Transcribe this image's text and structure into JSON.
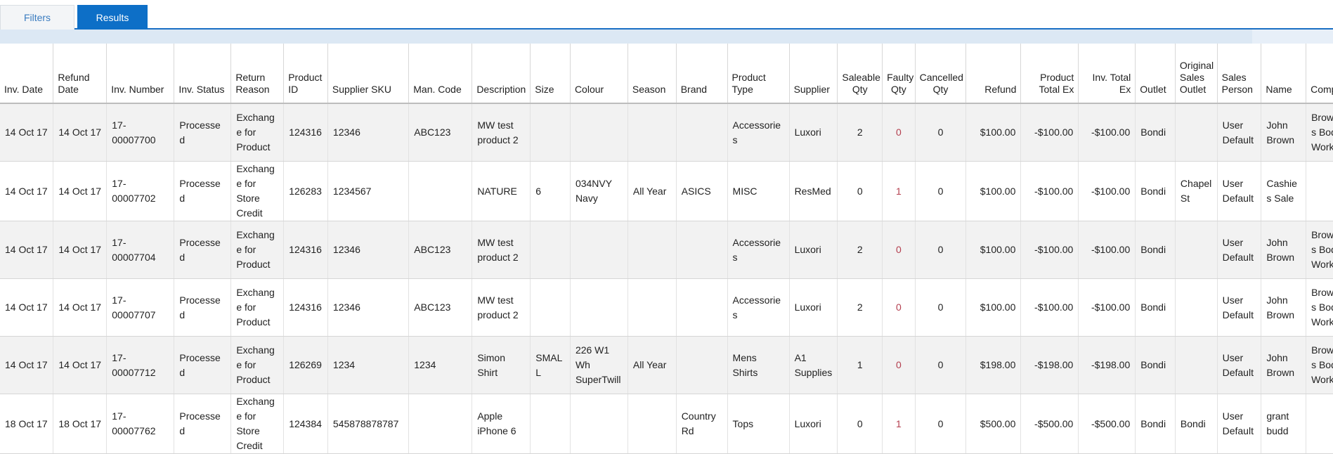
{
  "tabs": {
    "filters": "Filters",
    "results": "Results"
  },
  "columns": [
    {
      "label": "Inv. Date",
      "align": "l"
    },
    {
      "label": "Refund Date",
      "align": "l"
    },
    {
      "label": "Inv. Number",
      "align": "l"
    },
    {
      "label": "Inv. Status",
      "align": "l"
    },
    {
      "label": "Return Reason",
      "align": "l"
    },
    {
      "label": "Product ID",
      "align": "l"
    },
    {
      "label": "Supplier SKU",
      "align": "l"
    },
    {
      "label": "Man. Code",
      "align": "l"
    },
    {
      "label": "Description",
      "align": "l"
    },
    {
      "label": "Size",
      "align": "l"
    },
    {
      "label": "Colour",
      "align": "l"
    },
    {
      "label": "Season",
      "align": "l"
    },
    {
      "label": "Brand",
      "align": "l"
    },
    {
      "label": "Product Type",
      "align": "l"
    },
    {
      "label": "Supplier",
      "align": "l"
    },
    {
      "label": "Saleable Qty",
      "align": "c"
    },
    {
      "label": "Faulty Qty",
      "align": "c"
    },
    {
      "label": "Cancelled Qty",
      "align": "c"
    },
    {
      "label": "Refund",
      "align": "r"
    },
    {
      "label": "Product Total Ex",
      "align": "r"
    },
    {
      "label": "Inv. Total Ex",
      "align": "r"
    },
    {
      "label": "Outlet",
      "align": "l"
    },
    {
      "label": "Original Sales Outlet",
      "align": "l"
    },
    {
      "label": "Sales Person",
      "align": "l"
    },
    {
      "label": "Name",
      "align": "l"
    },
    {
      "label": "Company",
      "align": "l"
    }
  ],
  "rows": [
    [
      "14 Oct 17",
      "14 Oct 17",
      "17-00007700",
      "Processed",
      "Exchange for Product",
      "124316",
      "12346",
      "ABC123",
      "MW test product 2",
      "",
      "",
      "",
      "",
      "Accessories",
      "Luxori",
      "2",
      "0",
      "0",
      "$100.00",
      "-$100.00",
      "-$100.00",
      "Bondi",
      "",
      "User Default",
      "John Brown",
      "Browns Body Works"
    ],
    [
      "14 Oct 17",
      "14 Oct 17",
      "17-00007702",
      "Processed",
      "Exchange for Store Credit",
      "126283",
      "1234567",
      "",
      "NATURE",
      "6",
      "034NVY Navy",
      "All Year",
      "ASICS",
      "MISC",
      "ResMed",
      "0",
      "1",
      "0",
      "$100.00",
      "-$100.00",
      "-$100.00",
      "Bondi",
      "Chapel St",
      "User Default",
      "Cashies Sale",
      ""
    ],
    [
      "14 Oct 17",
      "14 Oct 17",
      "17-00007704",
      "Processed",
      "Exchange for Product",
      "124316",
      "12346",
      "ABC123",
      "MW test product 2",
      "",
      "",
      "",
      "",
      "Accessories",
      "Luxori",
      "2",
      "0",
      "0",
      "$100.00",
      "-$100.00",
      "-$100.00",
      "Bondi",
      "",
      "User Default",
      "John Brown",
      "Browns Body Works"
    ],
    [
      "14 Oct 17",
      "14 Oct 17",
      "17-00007707",
      "Processed",
      "Exchange for Product",
      "124316",
      "12346",
      "ABC123",
      "MW test product 2",
      "",
      "",
      "",
      "",
      "Accessories",
      "Luxori",
      "2",
      "0",
      "0",
      "$100.00",
      "-$100.00",
      "-$100.00",
      "Bondi",
      "",
      "User Default",
      "John Brown",
      "Browns Body Works"
    ],
    [
      "14 Oct 17",
      "14 Oct 17",
      "17-00007712",
      "Processed",
      "Exchange for Product",
      "126269",
      "1234",
      "1234",
      "Simon Shirt",
      "SMALL",
      "226 W1 Wh SuperTwill",
      "All Year",
      "",
      "Mens Shirts",
      "A1 Supplies",
      "1",
      "0",
      "0",
      "$198.00",
      "-$198.00",
      "-$198.00",
      "Bondi",
      "",
      "User Default",
      "John Brown",
      "Browns Body Works"
    ],
    [
      "18 Oct 17",
      "18 Oct 17",
      "17-00007762",
      "Processed",
      "Exchange for Store Credit",
      "124384",
      "545878878787",
      "",
      "Apple iPhone 6",
      "",
      "",
      "",
      "Country Rd",
      "Tops",
      "Luxori",
      "0",
      "1",
      "0",
      "$500.00",
      "-$500.00",
      "-$500.00",
      "Bondi",
      "Bondi",
      "User Default",
      "grant budd",
      ""
    ]
  ]
}
